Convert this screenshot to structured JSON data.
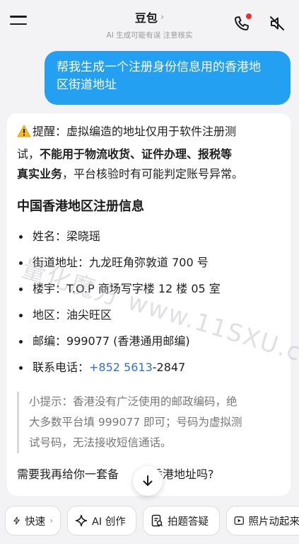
{
  "header": {
    "title": "豆包",
    "chevron": "›",
    "subtitle": "AI 生成可能有误 注意核实",
    "icons": [
      "menu-icon",
      "phone-call-icon",
      "speaker-muted-icon"
    ]
  },
  "user_message": {
    "line1": "帮我生成一个注册身份信息用的香港地",
    "line2": "区街道地址"
  },
  "answer": {
    "warning": {
      "icon": "warning-icon",
      "line1_a": "提醒：虚拟编造的地址仅用于软件注册测",
      "line2_a": "试，",
      "line2_b": "不能用于物流收货、证件办理、报税等",
      "line3_a": "真实业务",
      "line3_b": "，平台核验时有可能判定账号异常。"
    },
    "section_title": "中国香港地区注册信息",
    "items": [
      {
        "label": "姓名：",
        "value": "梁晓瑶"
      },
      {
        "label": "街道地址：",
        "value": "九龙旺角弥敦道 700 号"
      },
      {
        "label": "楼宇：",
        "value": "T.O.P 商场写字楼 12 楼 05 室"
      },
      {
        "label": "地区：",
        "value": "油尖旺区"
      },
      {
        "label": "邮编：",
        "value": "999077 (香港通用邮编)"
      }
    ],
    "phone": {
      "label": "联系电话：",
      "link": "+852 5613",
      "rest": "-2847"
    },
    "tip": {
      "line1": "小提示：香港没有广泛使用的邮政编码，绝",
      "line2": "大多数平台填 999077 即可；号码为虚拟测",
      "line3": "试号码，无法接收短信通话。"
    },
    "question": "需要我再给你一套备",
    "question_end": "香港地址吗?"
  },
  "watermark": "量化魔方 www.11SXU.com",
  "chips": [
    {
      "label": "快速",
      "icon": "bolt-icon",
      "chevron": "›"
    },
    {
      "label": "AI 创作",
      "icon": "sparkle-icon"
    },
    {
      "label": "拍题答疑",
      "icon": "photo-question-icon"
    },
    {
      "label": "照片动起来",
      "icon": "play-icon"
    }
  ],
  "colors": {
    "background": "#f3f3f5",
    "user_bubble": "#24a0f2",
    "link": "#2f6fd6",
    "notification_dot": "#e8302f"
  }
}
